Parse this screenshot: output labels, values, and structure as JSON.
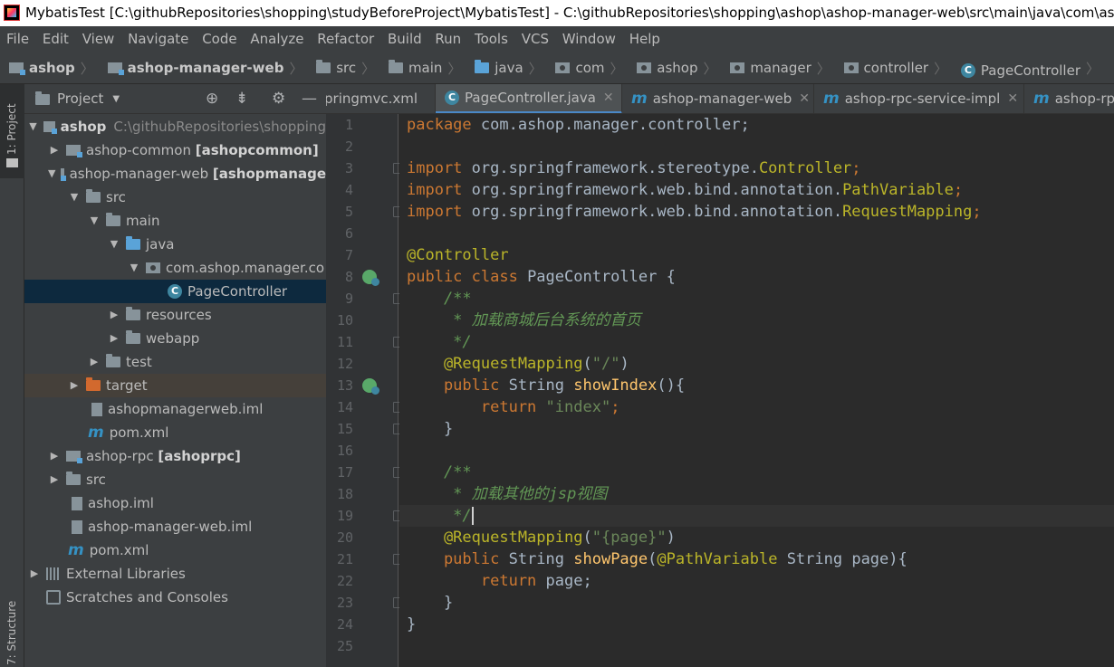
{
  "window": {
    "title": "MybatisTest [C:\\githubRepositories\\shopping\\studyBeforeProject\\MybatisTest] - C:\\githubRepositories\\shopping\\ashop\\ashop-manager-web\\src\\main\\java\\com\\ash"
  },
  "menu": [
    "File",
    "Edit",
    "View",
    "Navigate",
    "Code",
    "Analyze",
    "Refactor",
    "Build",
    "Run",
    "Tools",
    "VCS",
    "Window",
    "Help"
  ],
  "breadcrumb": [
    "ashop",
    "ashop-manager-web",
    "src",
    "main",
    "java",
    "com",
    "ashop",
    "manager",
    "controller",
    "PageController"
  ],
  "left_strip": {
    "project_tab": "1: Project",
    "structure_tab": "7: Structure"
  },
  "project_panel": {
    "title": "Project",
    "tree": [
      {
        "label": "ashop",
        "path": "C:\\githubRepositories\\shopping"
      },
      {
        "label": "ashop-common",
        "module": "[ashopcommon]"
      },
      {
        "label": "ashop-manager-web",
        "module": "[ashopmanage"
      },
      {
        "label": "src"
      },
      {
        "label": "main"
      },
      {
        "label": "java"
      },
      {
        "label": "com.ashop.manager.co"
      },
      {
        "label": "PageController"
      },
      {
        "label": "resources"
      },
      {
        "label": "webapp"
      },
      {
        "label": "test"
      },
      {
        "label": "target"
      },
      {
        "label": "ashopmanagerweb.iml"
      },
      {
        "label": "pom.xml"
      },
      {
        "label": "ashop-rpc",
        "module": "[ashoprpc]"
      },
      {
        "label": "src"
      },
      {
        "label": "ashop.iml"
      },
      {
        "label": "ashop-manager-web.iml"
      },
      {
        "label": "pom.xml"
      },
      {
        "label": "External Libraries"
      },
      {
        "label": "Scratches and Consoles"
      }
    ]
  },
  "editor_tabs": [
    "pringmvc.xml",
    "PageController.java",
    "ashop-manager-web",
    "ashop-rpc-service-impl",
    "ashop-rp"
  ],
  "code": {
    "line_numbers": [
      "1",
      "2",
      "3",
      "4",
      "5",
      "6",
      "7",
      "8",
      "9",
      "10",
      "11",
      "12",
      "13",
      "14",
      "15",
      "16",
      "17",
      "18",
      "19",
      "20",
      "21",
      "22",
      "23",
      "24",
      "25"
    ],
    "l1": {
      "kw": "package",
      "rest": " com.ashop.manager.controller;"
    },
    "l3": {
      "kw": "import",
      "rest": " org.springframework.stereotype.",
      "cls": "Controller",
      "end": ";"
    },
    "l4": {
      "kw": "import",
      "rest": " org.springframework.web.bind.annotation.",
      "cls": "PathVariable",
      "end": ";"
    },
    "l5": {
      "kw": "import",
      "rest": " org.springframework.web.bind.annotation.",
      "cls": "RequestMapping",
      "end": ";"
    },
    "l7": {
      "ann": "@Controller"
    },
    "l8": {
      "kw": "public class",
      "rest": " PageController {"
    },
    "l9": {
      "cm": "    /**"
    },
    "l10": {
      "cm": "     * 加载商城后台系统的首页"
    },
    "l11": {
      "cm": "     */"
    },
    "l12": {
      "ann": "    @RequestMapping",
      "p1": "(",
      "str": "\"/\"",
      "p2": ")"
    },
    "l13": {
      "kw": "    public",
      "t": " String ",
      "fn": "showIndex",
      "rest": "(){"
    },
    "l14": {
      "kw": "        return",
      "sp": " ",
      "str": "\"index\"",
      "end": ";"
    },
    "l15": {
      "t": "    }"
    },
    "l17": {
      "cm": "    /**"
    },
    "l18": {
      "cm": "     * 加载其他的jsp视图"
    },
    "l19": {
      "cm": "     */"
    },
    "l20": {
      "ann": "    @RequestMapping",
      "p1": "(",
      "str": "\"{page}\"",
      "p2": ")"
    },
    "l21": {
      "kw": "    public",
      "t": " String ",
      "fn": "showPage",
      "p1": "(",
      "ann": "@PathVariable",
      "rest": " String page){"
    },
    "l22": {
      "kw": "        return",
      "rest": " page;"
    },
    "l23": {
      "t": "    }"
    },
    "l24": {
      "t": "}"
    }
  },
  "colors": {
    "keyword": "#cc7832",
    "annotation": "#bbb529",
    "string": "#6a8759",
    "comment": "#629755",
    "method": "#ffc66d",
    "text": "#a9b7c6",
    "selection": "#0d293e"
  }
}
